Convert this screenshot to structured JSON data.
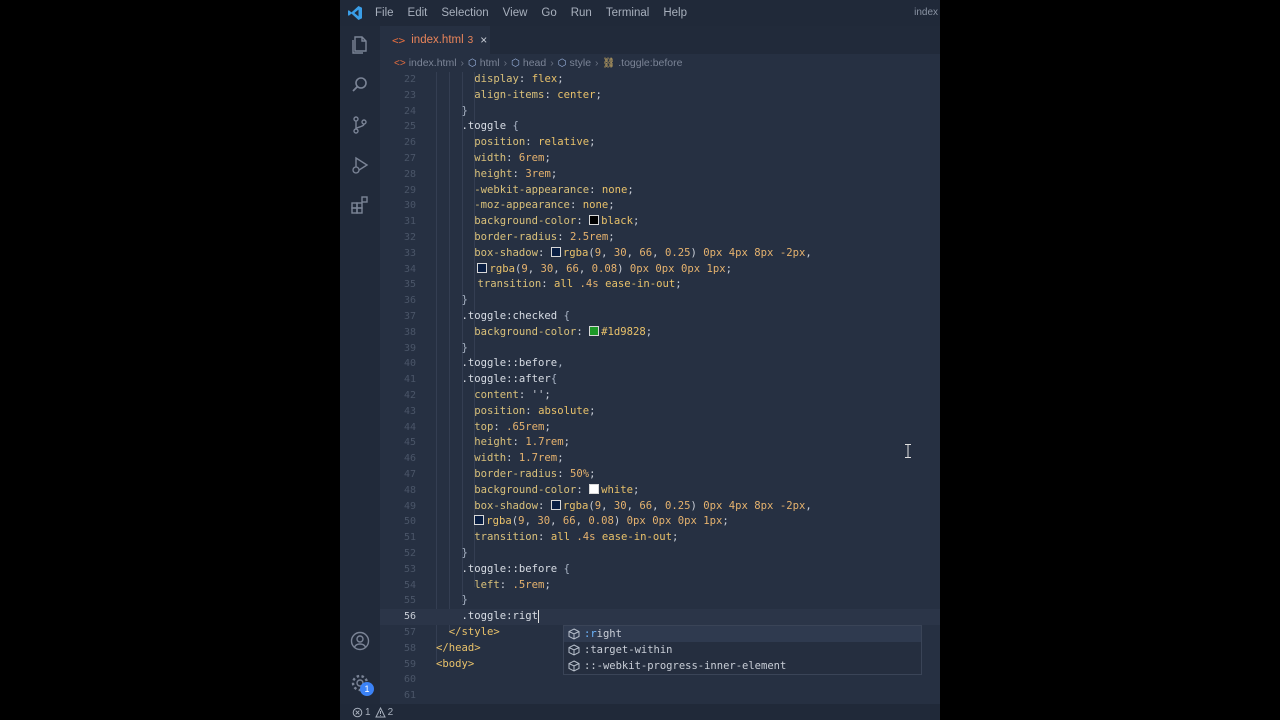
{
  "window": {
    "title_right": "index",
    "menu": [
      "File",
      "Edit",
      "Selection",
      "View",
      "Go",
      "Run",
      "Terminal",
      "Help"
    ]
  },
  "activitybar": {
    "icons": [
      "files-icon",
      "search-icon",
      "source-control-icon",
      "run-debug-icon",
      "extensions-icon",
      "account-icon",
      "settings-gear-icon"
    ],
    "settings_badge": "1"
  },
  "tab": {
    "name": "index.html",
    "problems": "3",
    "close": "×"
  },
  "breadcrumb": {
    "items": [
      {
        "icon": "<>",
        "label": "index.html"
      },
      {
        "icon": "cube",
        "label": "html"
      },
      {
        "icon": "cube",
        "label": "head"
      },
      {
        "icon": "cube",
        "label": "style"
      },
      {
        "icon": "css-rule",
        "label": ".toggle:before"
      }
    ]
  },
  "editor": {
    "current_line": "56",
    "lines": [
      {
        "n": "22",
        "text": "display: flex;"
      },
      {
        "n": "23",
        "text": "align-items: center;"
      },
      {
        "n": "24",
        "text": "}"
      },
      {
        "n": "25",
        "text": ".toggle {"
      },
      {
        "n": "26",
        "text": "position: relative;"
      },
      {
        "n": "27",
        "text": "width: 6rem;"
      },
      {
        "n": "28",
        "text": "height: 3rem;"
      },
      {
        "n": "29",
        "text": "-webkit-appearance: none;"
      },
      {
        "n": "30",
        "text": "-moz-appearance: none;"
      },
      {
        "n": "31",
        "text": "background-color: black;"
      },
      {
        "n": "32",
        "text": "border-radius: 2.5rem;"
      },
      {
        "n": "33",
        "text": "box-shadow: rgba(9, 30, 66, 0.25) 0px 4px 8px -2px,"
      },
      {
        "n": "34",
        "text": "rgba(9, 30, 66, 0.08) 0px 0px 0px 1px;"
      },
      {
        "n": "35",
        "text": "transition: all .4s ease-in-out;"
      },
      {
        "n": "36",
        "text": "}"
      },
      {
        "n": "37",
        "text": ".toggle:checked {"
      },
      {
        "n": "38",
        "text": "background-color: #1d9828;"
      },
      {
        "n": "39",
        "text": "}"
      },
      {
        "n": "40",
        "text": ".toggle::before,"
      },
      {
        "n": "41",
        "text": ".toggle::after{"
      },
      {
        "n": "42",
        "text": "content: '';"
      },
      {
        "n": "43",
        "text": "position: absolute;"
      },
      {
        "n": "44",
        "text": "top: .65rem;"
      },
      {
        "n": "45",
        "text": "height: 1.7rem;"
      },
      {
        "n": "46",
        "text": "width: 1.7rem;"
      },
      {
        "n": "47",
        "text": "border-radius: 50%;"
      },
      {
        "n": "48",
        "text": "background-color: white;"
      },
      {
        "n": "49",
        "text": "box-shadow: rgba(9, 30, 66, 0.25) 0px 4px 8px -2px,"
      },
      {
        "n": "50",
        "text": "rgba(9, 30, 66, 0.08) 0px 0px 0px 1px;"
      },
      {
        "n": "51",
        "text": "transition: all .4s ease-in-out;"
      },
      {
        "n": "52",
        "text": "}"
      },
      {
        "n": "53",
        "text": ".toggle::before {"
      },
      {
        "n": "54",
        "text": "left: .5rem;"
      },
      {
        "n": "55",
        "text": "}"
      },
      {
        "n": "56",
        "text": ".toggle:rigt"
      },
      {
        "n": "57",
        "text": "</style>"
      },
      {
        "n": "58",
        "text": "</head>"
      },
      {
        "n": "59",
        "text": "<body>"
      },
      {
        "n": "60",
        "text": ""
      },
      {
        "n": "61",
        "text": ""
      }
    ],
    "swatch_colors": {
      "black": "#000000",
      "rgba_dark": "#091e42",
      "green": "#1d9828",
      "white": "#ffffff"
    }
  },
  "suggest": {
    "items": [
      ":right",
      ":target-within",
      "::-webkit-progress-inner-element"
    ]
  },
  "statusbar": {
    "errors": "1",
    "warnings": "2"
  },
  "colors": {
    "accent": "#3b82f6",
    "editor_bg": "#263042",
    "tab_text": "#e8845a"
  }
}
